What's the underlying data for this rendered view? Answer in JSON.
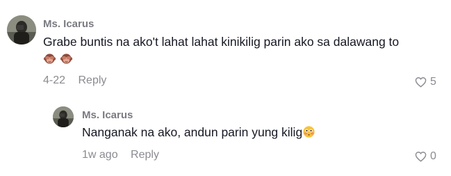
{
  "comments": [
    {
      "username": "Ms. Icarus",
      "text": "Grabe buntis na ako't lahat lahat kinikilig parin ako sa dalawang to",
      "emojis": [
        "see-no-evil-monkey",
        "see-no-evil-monkey"
      ],
      "date": "4-22",
      "reply_label": "Reply",
      "like_count": "5"
    },
    {
      "username": "Ms. Icarus",
      "text": "Nanganak na ako, andun parin yung kilig",
      "emojis": [
        "flushed-face"
      ],
      "date": "1w ago",
      "reply_label": "Reply",
      "like_count": "0"
    }
  ],
  "colors": {
    "text": "#161823",
    "muted": "#8a8b91",
    "username": "#7a7b82"
  }
}
